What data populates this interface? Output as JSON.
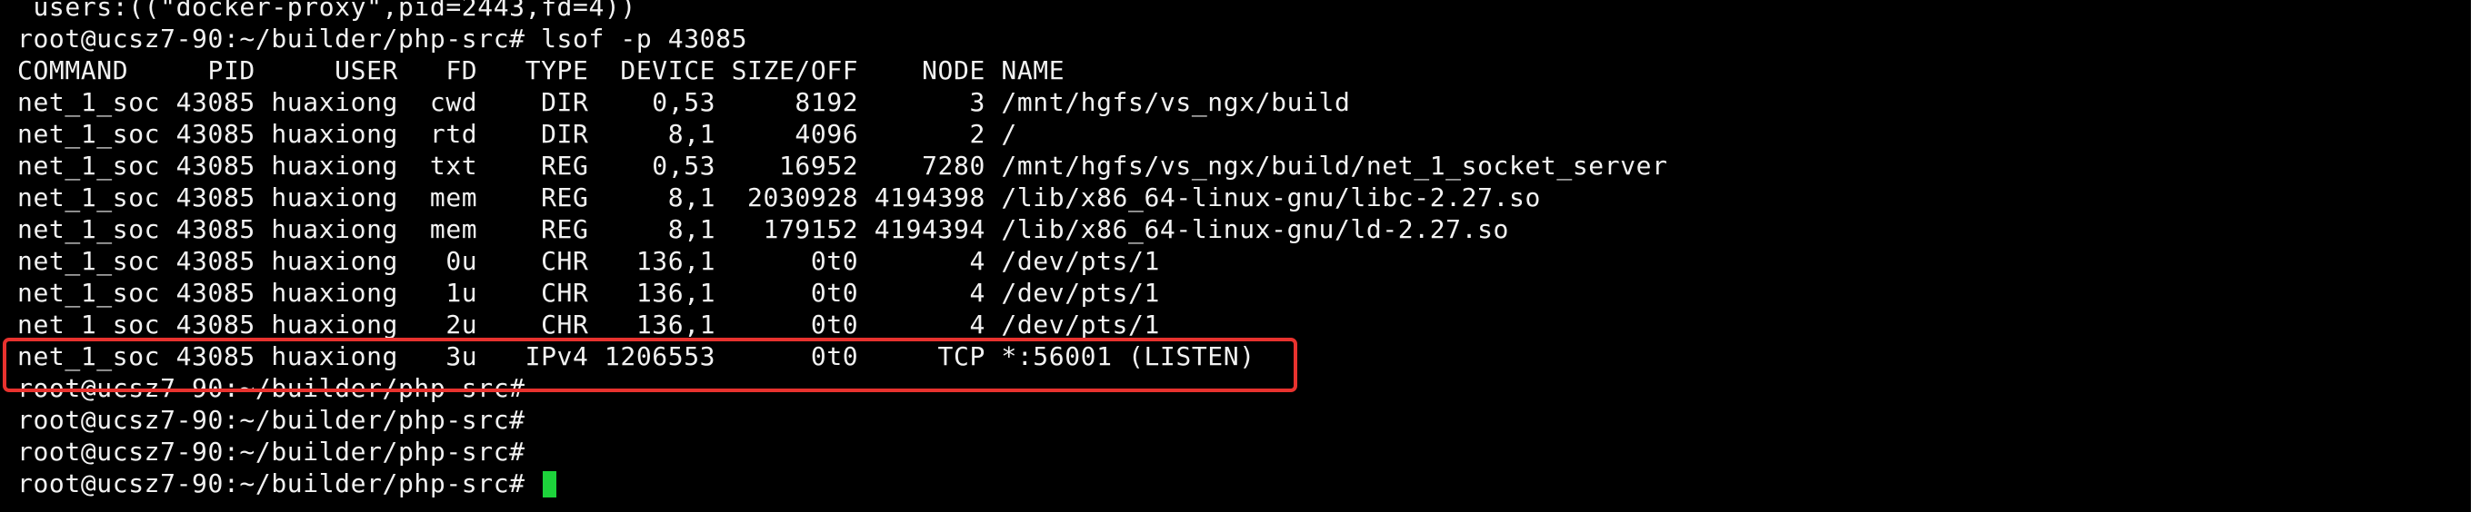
{
  "terminal": {
    "lines": [
      " users:((\"docker-proxy\",pid=2443,fd=4))",
      "root@ucsz7-90:~/builder/php-src# lsof -p 43085",
      "COMMAND     PID     USER   FD   TYPE  DEVICE SIZE/OFF    NODE NAME",
      "net_1_soc 43085 huaxiong  cwd    DIR    0,53     8192       3 /mnt/hgfs/vs_ngx/build",
      "net_1_soc 43085 huaxiong  rtd    DIR     8,1     4096       2 /",
      "net_1_soc 43085 huaxiong  txt    REG    0,53    16952    7280 /mnt/hgfs/vs_ngx/build/net_1_socket_server",
      "net_1_soc 43085 huaxiong  mem    REG     8,1  2030928 4194398 /lib/x86_64-linux-gnu/libc-2.27.so",
      "net_1_soc 43085 huaxiong  mem    REG     8,1   179152 4194394 /lib/x86_64-linux-gnu/ld-2.27.so",
      "net_1_soc 43085 huaxiong   0u    CHR   136,1      0t0       4 /dev/pts/1",
      "net_1_soc 43085 huaxiong   1u    CHR   136,1      0t0       4 /dev/pts/1",
      "net_1_soc 43085 huaxiong   2u    CHR   136,1      0t0       4 /dev/pts/1",
      "net_1_soc 43085 huaxiong   3u   IPv4 1206553      0t0     TCP *:56001 (LISTEN)",
      "root@ucsz7-90:~/builder/php-src#",
      "root@ucsz7-90:~/builder/php-src#",
      "root@ucsz7-90:~/builder/php-src#",
      "root@ucsz7-90:~/builder/php-src# "
    ]
  },
  "colors": {
    "background": "#000000",
    "text": "#f2f2f2",
    "cursor": "#1dd33b",
    "highlight_border": "#e8322e"
  }
}
